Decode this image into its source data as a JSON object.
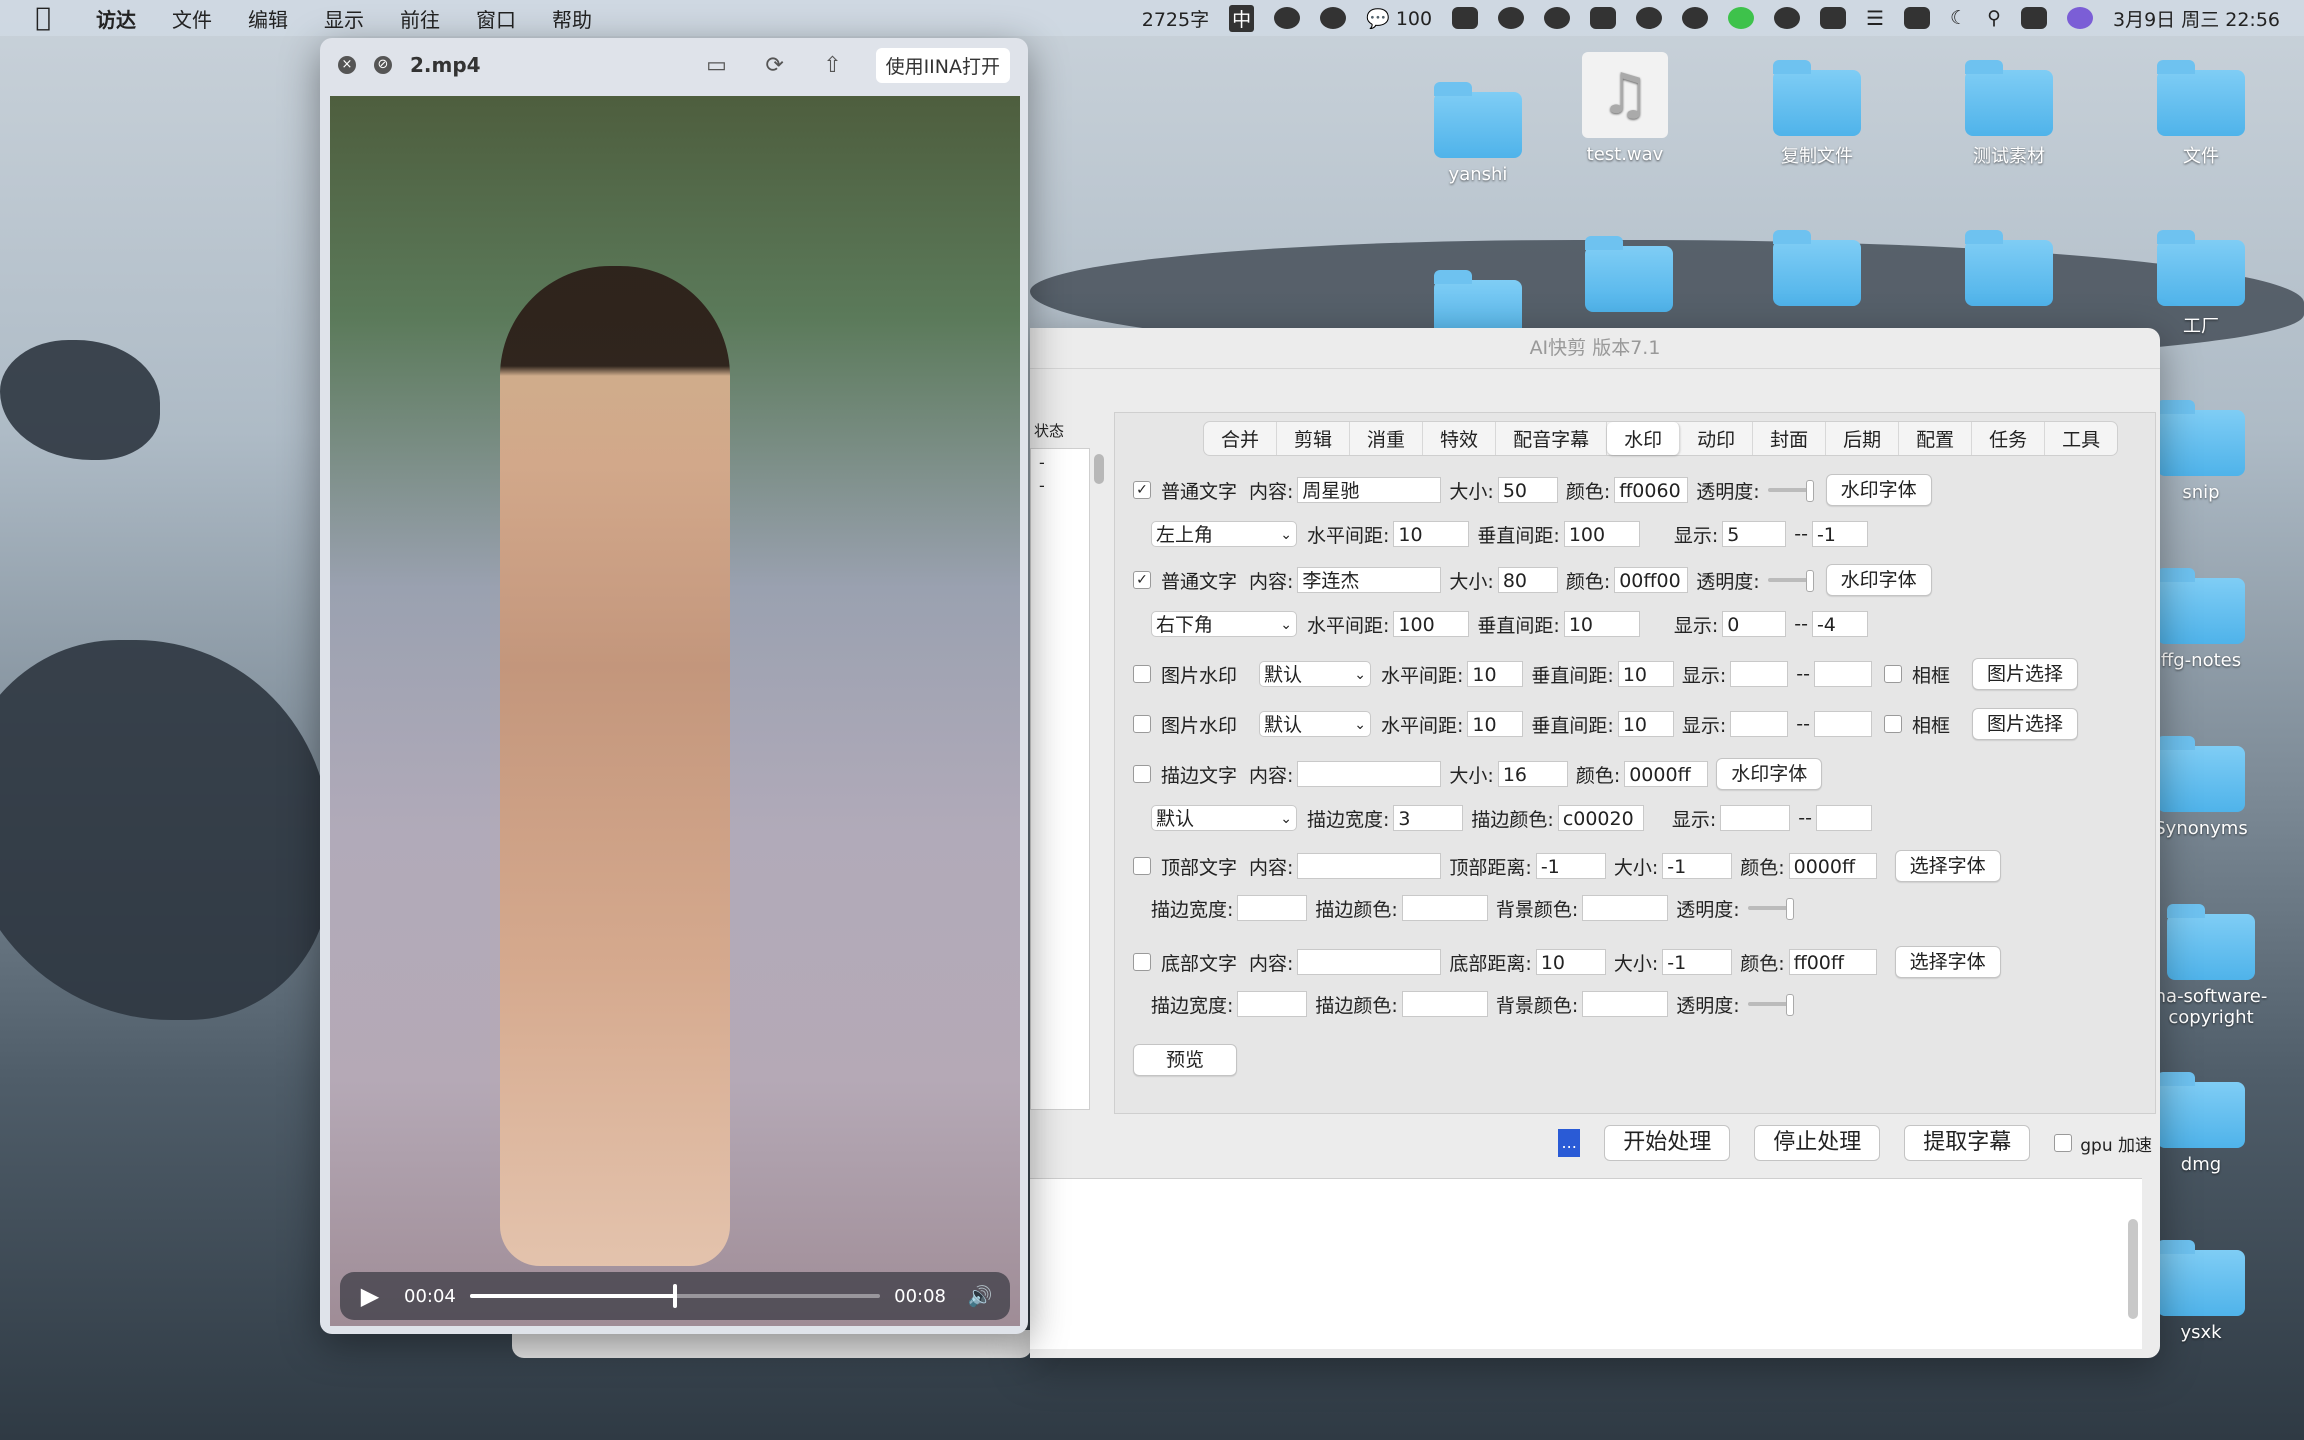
{
  "menubar": {
    "app": "访达",
    "items": [
      "文件",
      "编辑",
      "显示",
      "前往",
      "窗口",
      "帮助"
    ],
    "wordcount": "2725字",
    "ime": "中",
    "notifications": "100",
    "datetime": "3月9日 周三  22:56"
  },
  "desktop": {
    "icons": [
      "yanshi",
      "test.wav",
      "复制文件",
      "测试素材",
      "文件",
      "工厂",
      "snip",
      "ffg-notes",
      "Synonyms",
      "na-software-copyright",
      "dmg",
      "ysxk"
    ]
  },
  "player": {
    "title": "2.mp4",
    "open_label": "使用IINA打开",
    "current_time": "00:04",
    "total_time": "00:08",
    "progress": 0.5
  },
  "app": {
    "title": "AI快剪  版本7.1",
    "status_label": "状态",
    "status_rows": [
      "-",
      "-"
    ],
    "tabs": [
      "合并",
      "剪辑",
      "消重",
      "特效",
      "配音字幕",
      "水印",
      "动印",
      "封面",
      "后期",
      "配置",
      "任务",
      "工具"
    ],
    "active_tab": "水印",
    "wm1": {
      "type": "普通文字",
      "content_label": "内容:",
      "content": "周星驰",
      "size_label": "大小:",
      "size": "50",
      "color_label": "颜色:",
      "color": "ff0060",
      "opacity_label": "透明度:",
      "font_btn": "水印字体",
      "pos": "左上角",
      "h_label": "水平间距:",
      "h": "10",
      "v_label": "垂直间距:",
      "v": "100",
      "show_label": "显示:",
      "show_from": "5",
      "sep": "--",
      "show_to": "-1"
    },
    "wm2": {
      "type": "普通文字",
      "content": "李连杰",
      "size": "80",
      "color": "00ff00",
      "font_btn": "水印字体",
      "pos": "右下角",
      "h": "100",
      "v": "10",
      "show_from": "0",
      "show_to": "-4"
    },
    "img1": {
      "type": "图片水印",
      "pos": "默认",
      "h": "10",
      "v": "10",
      "frame_label": "相框",
      "btn": "图片选择"
    },
    "img2": {
      "type": "图片水印",
      "pos": "默认",
      "h": "10",
      "v": "10",
      "frame_label": "相框",
      "btn": "图片选择"
    },
    "stroke": {
      "type": "描边文字",
      "size": "16",
      "color": "0000ff",
      "font_btn": "水印字体",
      "pos": "默认",
      "stroke_w_label": "描边宽度:",
      "stroke_w": "3",
      "stroke_c_label": "描边颜色:",
      "stroke_c": "c00020"
    },
    "top": {
      "type": "顶部文字",
      "dist_label": "顶部距离:",
      "dist": "-1",
      "size": "-1",
      "color": "0000ff",
      "font_btn": "选择字体",
      "bg_label": "背景颜色:"
    },
    "bottom": {
      "type": "底部文字",
      "dist_label": "底部距离:",
      "dist": "10",
      "size": "-1",
      "color": "ff00ff",
      "font_btn": "选择字体"
    },
    "preview": "预览",
    "dots": "...",
    "start": "开始处理",
    "stop": "停止处理",
    "extract": "提取字幕",
    "gpu": "gpu 加速"
  }
}
